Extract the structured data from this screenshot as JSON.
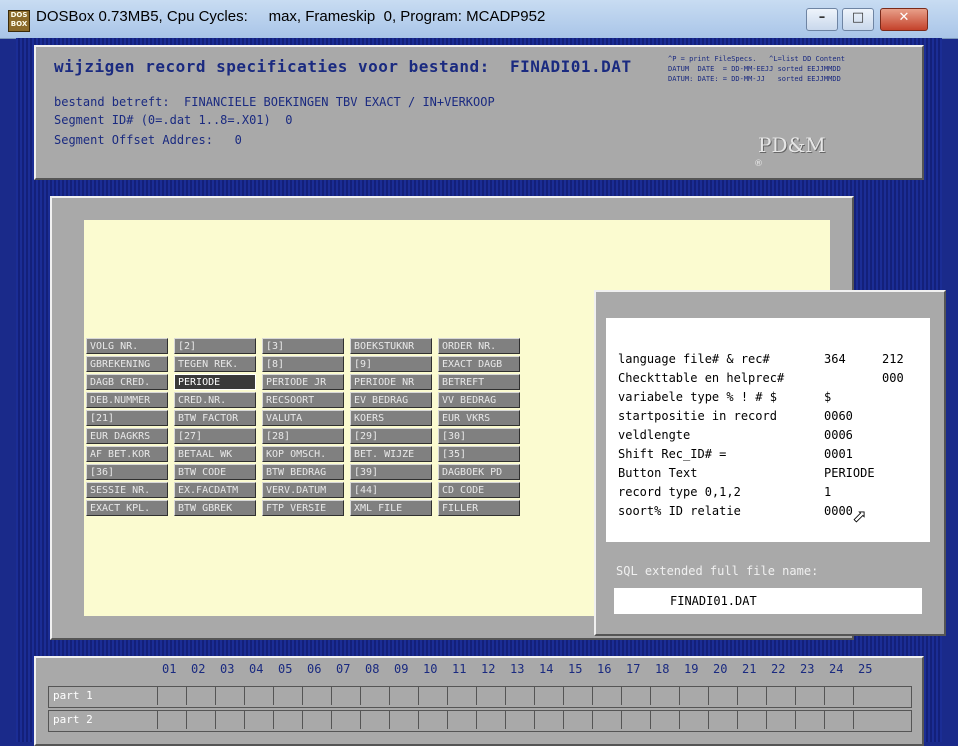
{
  "window": {
    "title": "DOSBox 0.73MB5, Cpu Cycles:     max, Frameskip  0, Program: MCADP952",
    "app_icon_text": "DOS BOX",
    "min_glyph": "–",
    "max_glyph": "□",
    "close_glyph": "✕"
  },
  "header": {
    "title": "wijzigen record specificaties voor bestand:  FINADI01.DAT",
    "line1": "bestand betreft:  FINANCIELE BOEKINGEN TBV EXACT / IN+VERKOOP",
    "line2": "Segment ID# (0=.dat 1..8=.X01)  0",
    "line3": "Segment Offset Addres:   0",
    "hint1": "^P = print FileSpecs.   ^L=list DD Content",
    "hint2": "DATUM  DATE  = DD-MM-EEJJ sorted EEJJMMDD",
    "hint3": "DATUM: DATE: = DD-MM-JJ   sorted EEJJMMDD",
    "logo": "PD&M",
    "logo_mark": "®"
  },
  "fields": [
    [
      "VOLG NR.",
      "[2]",
      "[3]",
      "BOEKSTUKNR",
      "ORDER NR."
    ],
    [
      "GBREKENING",
      "TEGEN REK.",
      "[8]",
      "[9]",
      "EXACT DAGB"
    ],
    [
      "DAGB CRED.",
      "PERIODE",
      "PERIODE JR",
      "PERIODE NR",
      "BETREFT"
    ],
    [
      "DEB.NUMMER",
      "CRED.NR.",
      "RECSOORT",
      "EV BEDRAG",
      "VV BEDRAG"
    ],
    [
      "[21]",
      "BTW FACTOR",
      "VALUTA",
      "KOERS",
      "EUR VKRS"
    ],
    [
      "EUR DAGKRS",
      "[27]",
      "[28]",
      "[29]",
      "[30]"
    ],
    [
      "AF BET.KOR",
      "BETAAL WK",
      "KOP OMSCH.",
      "BET. WIJZE",
      "[35]"
    ],
    [
      "[36]",
      "BTW CODE",
      "BTW BEDRAG",
      "[39]",
      "DAGBOEK PD"
    ],
    [
      "SESSIE NR.",
      "EX.FACDATM",
      "VERV.DATUM",
      "[44]",
      "CD CODE"
    ],
    [
      "EXACT KPL.",
      "BTW GBREK",
      "FTP VERSIE",
      "XML FILE",
      "FILLER"
    ]
  ],
  "info": {
    "rows": [
      {
        "label": "language file# & rec#",
        "value": "364",
        "value2": "212"
      },
      {
        "label": "Checkttable en helprec#",
        "value": "",
        "value2": "000"
      },
      {
        "label": "variabele type % ! # $",
        "value": "$",
        "value2": ""
      },
      {
        "label": "startpositie in record",
        "value": "0060",
        "value2": ""
      },
      {
        "label": "veldlengte",
        "value": "0006",
        "value2": ""
      },
      {
        "label": "Shift Rec_ID# =",
        "value": "0001",
        "value2": ""
      },
      {
        "label": "Button Text",
        "value": "PERIODE",
        "value2": ""
      },
      {
        "label": "record type 0,1,2",
        "value": "1",
        "value2": ""
      },
      {
        "label": "soort% ID relatie",
        "value": "0000",
        "value2": ""
      }
    ],
    "sql_label": "SQL extended full file name:",
    "sql_value": "FINADI01.DAT"
  },
  "parts": {
    "numbers": [
      "01",
      "02",
      "03",
      "04",
      "05",
      "06",
      "07",
      "08",
      "09",
      "10",
      "11",
      "12",
      "13",
      "14",
      "15",
      "16",
      "17",
      "18",
      "19",
      "20",
      "21",
      "22",
      "23",
      "24",
      "25"
    ],
    "rows": [
      "part 1",
      "part 2"
    ]
  }
}
